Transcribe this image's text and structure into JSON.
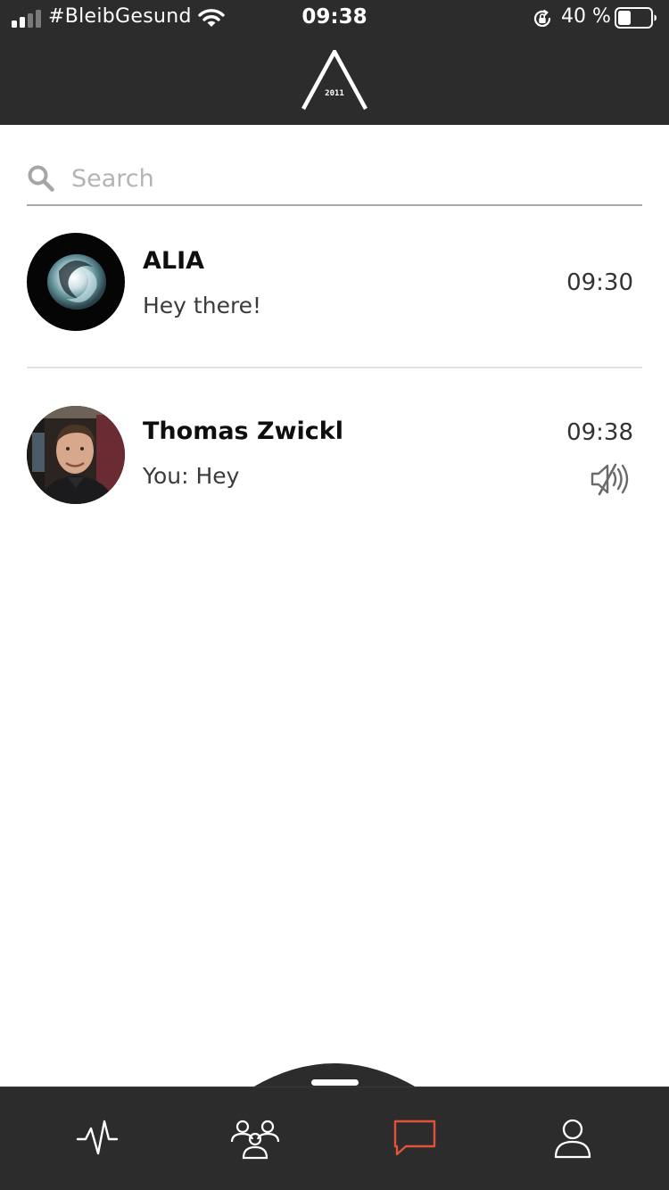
{
  "status_bar": {
    "carrier": "#BleibGesund",
    "time": "09:38",
    "battery_percent": "40 %",
    "battery_level": 0.4
  },
  "header": {
    "logo_text": "2011"
  },
  "search": {
    "placeholder": "Search",
    "value": ""
  },
  "chats": [
    {
      "name": "ALIA",
      "last_message": "Hey there!",
      "time": "09:30",
      "muted": false
    },
    {
      "name": "Thomas Zwickl",
      "last_message": "You: Hey",
      "time": "09:38",
      "muted": true
    }
  ],
  "tabbar": {
    "tabs": [
      {
        "icon": "activity-pulse-icon",
        "active": false
      },
      {
        "icon": "community-group-icon",
        "active": false
      },
      {
        "icon": "chat-bubble-icon",
        "active": true
      },
      {
        "icon": "profile-user-icon",
        "active": false
      }
    ]
  },
  "colors": {
    "bar_background": "#2c2c2c",
    "accent": "#e0533a",
    "icon_inactive": "#ffffff",
    "text_primary": "#0e0e0e",
    "text_secondary": "#3b3b3b"
  }
}
